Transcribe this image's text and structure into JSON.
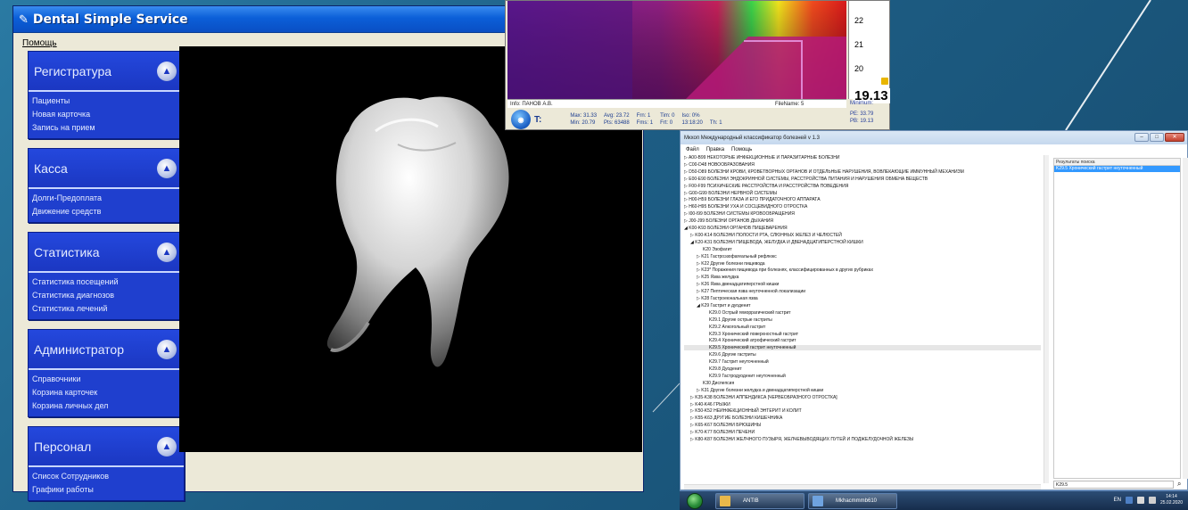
{
  "dental": {
    "title": "Dental Simple Service",
    "menu": "Помощь",
    "panels": [
      {
        "title": "Регистратура",
        "items": [
          "Пациенты",
          "Новая карточка",
          "Запись на прием"
        ]
      },
      {
        "title": "Касса",
        "items": [
          "Долги-Предоплата",
          "Движение средств"
        ]
      },
      {
        "title": "Статистика",
        "items": [
          "Статистика посещений",
          "Статистика диагнозов",
          "Статистика лечений"
        ]
      },
      {
        "title": "Администратор",
        "items": [
          "Справочники",
          "Корзина карточек",
          "Корзина личных дел"
        ]
      },
      {
        "title": "Персонал",
        "items": [
          "Список Сотрудников",
          "Графики работы"
        ]
      }
    ]
  },
  "thermal": {
    "scale_ticks": [
      "22",
      "21",
      "20"
    ],
    "current_value": "19.13",
    "minimum_label": "Minimum:",
    "info_label": "Info: ПАНОВ А.В.",
    "filename_label": "FileName: 5",
    "t_label": "T:",
    "stats": {
      "max": "Max: 31.33",
      "min": "Min: 20.79",
      "avg": "Avg: 23.72",
      "pts": "Pts: 63488",
      "frn": "Frn: 1",
      "fms": "Fms: 1",
      "tim": "Tim: 0",
      "frt": "Frt: 0",
      "iso": "Iso: 0%",
      "time": "13:18:20",
      "th": "Th: 1"
    },
    "pe": "PE: 33.79",
    "pb": "PB: 19.13"
  },
  "icd": {
    "title": "Мкхоп Международный классификатор болезней v 1.3",
    "menu": [
      "Файл",
      "Правка",
      "Помощь"
    ],
    "tree": [
      {
        "text": "▷ A00-B99 НЕКОТОРЫЕ ИНФЕКЦИОННЫЕ И ПАРАЗИТАРНЫЕ БОЛЕЗНИ",
        "lvl": 0
      },
      {
        "text": "▷ C00-D48 НОВООБРАЗОВАНИЯ",
        "lvl": 0
      },
      {
        "text": "▷ D50-D89 БОЛЕЗНИ КРОВИ, КРОВЕТВОРНЫХ ОРГАНОВ И ОТДЕЛЬНЫЕ НАРУШЕНИЯ, ВОВЛЕКАЮЩИЕ ИММУННЫЙ МЕХАНИЗМ",
        "lvl": 0
      },
      {
        "text": "▷ E00-E90 БОЛЕЗНИ ЭНДОКРИННОЙ СИСТЕМЫ, РАССТРОЙСТВА ПИТАНИЯ И НАРУШЕНИЯ ОБМЕНА ВЕЩЕСТВ",
        "lvl": 0
      },
      {
        "text": "▷ F00-F99 ПСИХИЧЕСКИЕ РАССТРОЙСТВА И РАССТРОЙСТВА ПОВЕДЕНИЯ",
        "lvl": 0
      },
      {
        "text": "▷ G00-G99 БОЛЕЗНИ НЕРВНОЙ СИСТЕМЫ",
        "lvl": 0
      },
      {
        "text": "▷ H00-H59 БОЛЕЗНИ ГЛАЗА И ЕГО ПРИДАТОЧНОГО АППАРАТА",
        "lvl": 0
      },
      {
        "text": "▷ H60-H95 БОЛЕЗНИ УХА И СОСЦЕВИДНОГО ОТРОСТКА",
        "lvl": 0
      },
      {
        "text": "▷ I00-I99 БОЛЕЗНИ СИСТЕМЫ КРОВООБРАЩЕНИЯ",
        "lvl": 0
      },
      {
        "text": "▷ J00-J99 БОЛЕЗНИ ОРГАНОВ ДЫХАНИЯ",
        "lvl": 0
      },
      {
        "text": "◢ K00-K93 БОЛЕЗНИ ОРГАНОВ ПИЩЕВАРЕНИЯ",
        "lvl": 0
      },
      {
        "text": "▷ K00-K14 БОЛЕЗНИ ПОЛОСТИ РТА, СЛЮННЫХ ЖЕЛЕЗ И ЧЕЛЮСТЕЙ",
        "lvl": 1
      },
      {
        "text": "◢ K20-K31 БОЛЕЗНИ ПИЩЕВОДА, ЖЕЛУДКА И ДВЕНАДЦАТИПЕРСТНОЙ КИШКИ",
        "lvl": 1
      },
      {
        "text": "K20 Эзофагит",
        "lvl": 3
      },
      {
        "text": "▷ K21 Гастроэзофагеальный рефлюкс",
        "lvl": 2
      },
      {
        "text": "▷ K22 Другие болезни пищевода",
        "lvl": 2
      },
      {
        "text": "▷ K23* Поражения пищевода при болезнях, классифицированных в других рубриках",
        "lvl": 2
      },
      {
        "text": "▷ K25 Язва желудка",
        "lvl": 2
      },
      {
        "text": "▷ K26 Язва двенадцатиперстной кишки",
        "lvl": 2
      },
      {
        "text": "▷ K27 Пептическая язва неуточненной локализации",
        "lvl": 2
      },
      {
        "text": "▷ K28 Гастроеюнальная язва",
        "lvl": 2
      },
      {
        "text": "◢ K29 Гастрит и дуоденит",
        "lvl": 2
      },
      {
        "text": "K29.0 Острый геморрагический гастрит",
        "lvl": 4
      },
      {
        "text": "K29.1 Другие острые гастриты",
        "lvl": 4
      },
      {
        "text": "K29.2 Алкогольный гастрит",
        "lvl": 4
      },
      {
        "text": "K29.3 Хронический поверхностный гастрит",
        "lvl": 4
      },
      {
        "text": "K29.4 Хронический атрофический гастрит",
        "lvl": 4
      },
      {
        "text": "K29.5 Хронический гастрит неуточненный",
        "lvl": 4,
        "selected": true
      },
      {
        "text": "K29.6 Другие гастриты",
        "lvl": 4
      },
      {
        "text": "K29.7 Гастрит неуточненный",
        "lvl": 4
      },
      {
        "text": "K29.8 Дуоденит",
        "lvl": 4
      },
      {
        "text": "K29.9 Гастродуоденит неуточненный",
        "lvl": 4
      },
      {
        "text": "K30 Диспепсия",
        "lvl": 3
      },
      {
        "text": "▷ K31 Другие болезни желудка и двенадцатиперстной кишки",
        "lvl": 2
      },
      {
        "text": "▷ K35-K38 БОЛЕЗНИ АППЕНДИКСА [ЧЕРВЕОБРАЗНОГО ОТРОСТКА]",
        "lvl": 1
      },
      {
        "text": "▷ K40-K46 ГРЫЖИ",
        "lvl": 1
      },
      {
        "text": "▷ K50-K52 НЕИНФЕКЦИОННЫЙ ЭНТЕРИТ И КОЛИТ",
        "lvl": 1
      },
      {
        "text": "▷ K55-K63 ДРУГИЕ БОЛЕЗНИ КИШЕЧНИКА",
        "lvl": 1
      },
      {
        "text": "▷ K65-K67 БОЛЕЗНИ БРЮШИНЫ",
        "lvl": 1
      },
      {
        "text": "▷ K70-K77 БОЛЕЗНИ ПЕЧЕНИ",
        "lvl": 1
      },
      {
        "text": "▷ K80-K87 БОЛЕЗНИ ЖЕЛЧНОГО ПУЗЫРЯ, ЖЕЛЧЕВЫВОДЯЩИХ ПУТЕЙ И ПОДЖЕЛУДОЧНОЙ ЖЕЛЕЗЫ",
        "lvl": 1
      }
    ],
    "results_header": "Результаты поиска",
    "result_item": "K29.5 Хронический гастрит неуточненный",
    "search_value": "K29.5"
  },
  "taskbar": {
    "tasks": [
      "ANTIB",
      "Мkhacmmmb610"
    ],
    "lang": "EN",
    "time": "14:14",
    "date": "25.02.2020"
  }
}
